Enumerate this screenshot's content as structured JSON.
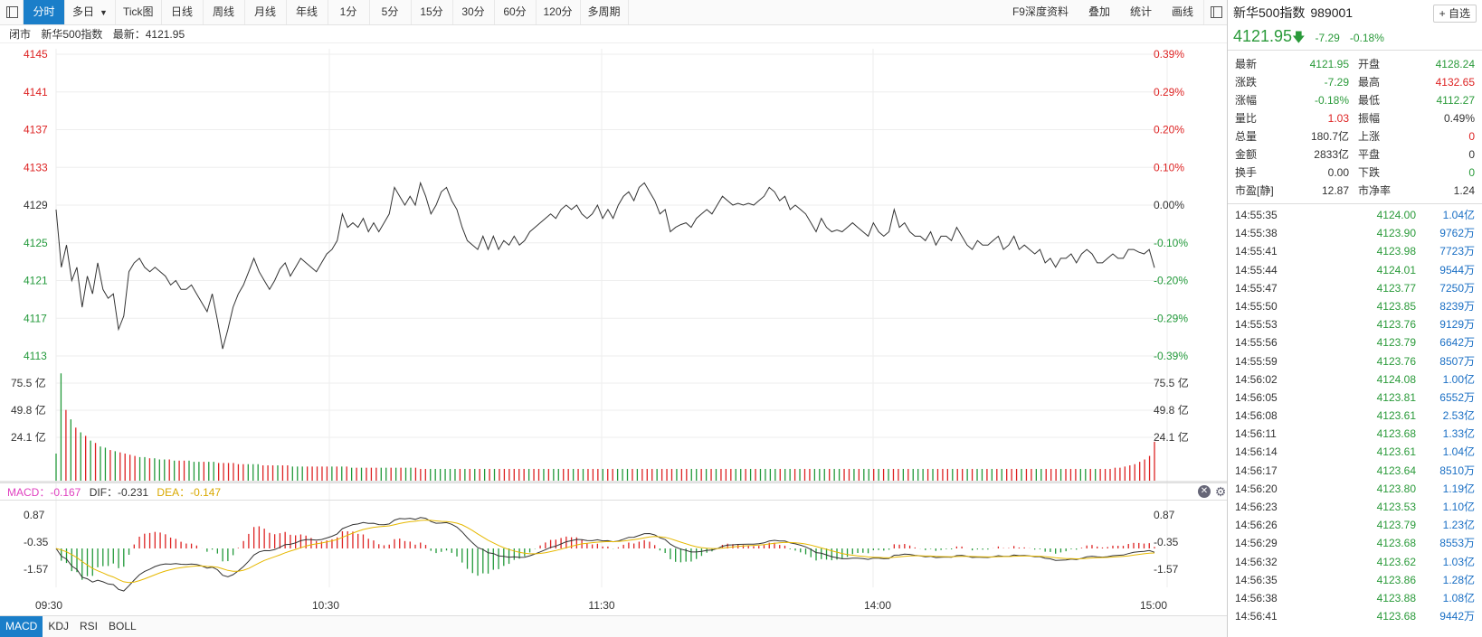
{
  "toolbar": {
    "tabs": [
      "分时",
      "多日",
      "Tick图",
      "日线",
      "周线",
      "月线",
      "年线",
      "1分",
      "5分",
      "15分",
      "30分",
      "60分",
      "120分",
      "多周期"
    ],
    "active": "分时",
    "dropdown_arrow": "▼",
    "right": [
      "F9深度资料",
      "叠加",
      "统计",
      "画线"
    ]
  },
  "info": {
    "status": "闭市",
    "name": "新华500指数",
    "latest": "最新：4121.95"
  },
  "price_axis_left": [
    "4145",
    "4141",
    "4137",
    "4133",
    "4129",
    "4125",
    "4121",
    "4117",
    "4113"
  ],
  "price_axis_right": [
    "0.39%",
    "0.29%",
    "0.20%",
    "0.10%",
    "0.00%",
    "-0.10%",
    "-0.20%",
    "-0.29%",
    "-0.39%"
  ],
  "volume_axis": [
    "75.5 亿",
    "49.8 亿",
    "24.1 亿"
  ],
  "macd_axis": [
    "0.87",
    "-0.35",
    "-1.57"
  ],
  "time_axis": [
    "09:30",
    "10:30",
    "11:30",
    "14:00",
    "15:00"
  ],
  "macd_header": {
    "macd": "MACD：-0.167",
    "dif": "DIF：-0.231",
    "dea": "DEA：-0.147"
  },
  "bottom_tabs": [
    "MACD",
    "KDJ",
    "RSI",
    "BOLL"
  ],
  "colors": {
    "up": "#dd2222",
    "down": "#22993a",
    "accent": "#1a7ec9",
    "line": "#333333",
    "dea": "#e6b800",
    "macd": "#e040c0"
  },
  "panel": {
    "name": "新华500指数",
    "code": "989001",
    "add_label": "+ 自选",
    "price": "4121.95",
    "arrow": "🡇",
    "change": "-7.29",
    "pct": "-0.18%",
    "quotes": [
      {
        "l1": "最新",
        "v1": "4121.95",
        "c1": "green",
        "l2": "开盘",
        "v2": "4128.24",
        "c2": "green"
      },
      {
        "l1": "涨跌",
        "v1": "-7.29",
        "c1": "green",
        "l2": "最高",
        "v2": "4132.65",
        "c2": "red"
      },
      {
        "l1": "涨幅",
        "v1": "-0.18%",
        "c1": "green",
        "l2": "最低",
        "v2": "4112.27",
        "c2": "green"
      },
      {
        "l1": "量比",
        "v1": "1.03",
        "c1": "red",
        "l2": "振幅",
        "v2": "0.49%",
        "c2": "black"
      },
      {
        "l1": "总量",
        "v1": "180.7亿",
        "c1": "black",
        "l2": "上涨",
        "v2": "0",
        "c2": "red"
      },
      {
        "l1": "金额",
        "v1": "2833亿",
        "c1": "black",
        "l2": "平盘",
        "v2": "0",
        "c2": "black"
      },
      {
        "l1": "换手",
        "v1": "0.00",
        "c1": "black",
        "l2": "下跌",
        "v2": "0",
        "c2": "green"
      },
      {
        "l1": "市盈[静]",
        "v1": "12.87",
        "c1": "black",
        "l2": "市净率",
        "v2": "1.24",
        "c2": "black"
      }
    ],
    "ticks": [
      [
        "14:55:35",
        "4124.00",
        "1.04亿"
      ],
      [
        "14:55:38",
        "4123.90",
        "9762万"
      ],
      [
        "14:55:41",
        "4123.98",
        "7723万"
      ],
      [
        "14:55:44",
        "4124.01",
        "9544万"
      ],
      [
        "14:55:47",
        "4123.77",
        "7250万"
      ],
      [
        "14:55:50",
        "4123.85",
        "8239万"
      ],
      [
        "14:55:53",
        "4123.76",
        "9129万"
      ],
      [
        "14:55:56",
        "4123.79",
        "6642万"
      ],
      [
        "14:55:59",
        "4123.76",
        "8507万"
      ],
      [
        "14:56:02",
        "4124.08",
        "1.00亿"
      ],
      [
        "14:56:05",
        "4123.81",
        "6552万"
      ],
      [
        "14:56:08",
        "4123.61",
        "2.53亿"
      ],
      [
        "14:56:11",
        "4123.68",
        "1.33亿"
      ],
      [
        "14:56:14",
        "4123.61",
        "1.04亿"
      ],
      [
        "14:56:17",
        "4123.64",
        "8510万"
      ],
      [
        "14:56:20",
        "4123.80",
        "1.19亿"
      ],
      [
        "14:56:23",
        "4123.53",
        "1.10亿"
      ],
      [
        "14:56:26",
        "4123.79",
        "1.23亿"
      ],
      [
        "14:56:29",
        "4123.68",
        "8553万"
      ],
      [
        "14:56:32",
        "4123.62",
        "1.03亿"
      ],
      [
        "14:56:35",
        "4123.86",
        "1.28亿"
      ],
      [
        "14:56:38",
        "4123.88",
        "1.08亿"
      ],
      [
        "14:56:41",
        "4123.68",
        "9442万"
      ]
    ]
  },
  "chart_data": {
    "type": "line",
    "x_ticks": [
      "09:30",
      "10:30",
      "11:30",
      "14:00",
      "15:00"
    ],
    "prev_close": 4129.24,
    "ylim": [
      4112,
      4146
    ],
    "price": [
      4128.5,
      4122,
      4124.5,
      4120.5,
      4122,
      4117.5,
      4121,
      4119,
      4122.5,
      4119.5,
      4118.5,
      4119,
      4115,
      4116.5,
      4121.5,
      4122.5,
      4123,
      4122,
      4121.5,
      4122,
      4121.5,
      4121,
      4120,
      4120.5,
      4119.5,
      4119.5,
      4120,
      4119,
      4118,
      4117,
      4119,
      4116,
      4112.8,
      4115,
      4117.5,
      4119,
      4120,
      4121.5,
      4123,
      4121.5,
      4120.5,
      4119.5,
      4120.5,
      4121.8,
      4122.5,
      4121,
      4122,
      4123,
      4122.5,
      4122,
      4121.5,
      4122.5,
      4123.5,
      4124,
      4125,
      4128,
      4126.5,
      4127,
      4126.5,
      4127.5,
      4126,
      4127,
      4126,
      4127,
      4128,
      4131,
      4130,
      4129,
      4130,
      4129,
      4131.5,
      4130,
      4128,
      4129,
      4130.5,
      4131,
      4129.5,
      4128.5,
      4126.5,
      4125,
      4124.5,
      4124,
      4125.5,
      4124,
      4125.5,
      4124,
      4125,
      4124.5,
      4125.5,
      4124.5,
      4125,
      4126,
      4126.5,
      4127,
      4127.5,
      4128,
      4127.5,
      4128.5,
      4129,
      4128.5,
      4129,
      4128,
      4127.5,
      4128,
      4129,
      4127.5,
      4128.5,
      4127.5,
      4129,
      4130,
      4130.5,
      4129.5,
      4131,
      4131.5,
      4130.5,
      4129.5,
      4128,
      4128.5,
      4126,
      4126.5,
      4126.8,
      4127,
      4126.5,
      4127.5,
      4128,
      4128.5,
      4128,
      4129,
      4130,
      4129.5,
      4129,
      4129.2,
      4129,
      4129.2,
      4129,
      4129.5,
      4130,
      4131,
      4130.5,
      4129.5,
      4130,
      4128.5,
      4129,
      4128.5,
      4128,
      4127,
      4126,
      4127.5,
      4126.5,
      4126,
      4126.2,
      4126,
      4126.5,
      4127,
      4126.5,
      4126,
      4125.5,
      4127,
      4126,
      4125.5,
      4126,
      4128.5,
      4126.5,
      4127,
      4126,
      4125.5,
      4125.5,
      4125,
      4126,
      4124.5,
      4125.5,
      4125.5,
      4125,
      4126.5,
      4125.5,
      4124.5,
      4124,
      4125,
      4124.5,
      4124.5,
      4125,
      4125.5,
      4124,
      4124.5,
      4125.5,
      4124,
      4124.5,
      4124,
      4123.5,
      4124,
      4122.5,
      4123,
      4122,
      4123,
      4123,
      4123.5,
      4122.5,
      4123.5,
      4124,
      4123.5,
      4122.5,
      4122.5,
      4123,
      4123.5,
      4123,
      4123,
      4124,
      4124,
      4123.7,
      4123.5,
      4124,
      4121.95
    ],
    "volume": [
      23,
      91,
      60,
      52,
      45,
      41,
      38,
      34,
      32,
      29,
      28,
      26,
      25,
      24,
      23,
      22,
      21,
      20,
      20,
      19,
      19,
      18,
      18,
      18,
      17,
      17,
      17,
      17,
      16,
      16,
      16,
      16,
      16,
      15,
      15,
      15,
      15,
      14,
      14,
      14,
      14,
      14,
      13,
      13,
      13,
      13,
      13,
      13,
      12,
      12,
      12,
      12,
      12,
      12,
      12,
      12,
      12,
      12,
      12,
      12,
      11,
      11,
      11,
      11,
      11,
      11,
      11,
      11,
      11,
      11,
      11,
      11,
      11,
      11,
      10,
      10,
      10,
      10,
      10,
      10,
      10,
      10,
      10,
      10,
      10,
      10,
      10,
      10,
      10,
      10,
      10,
      10,
      10,
      10,
      10,
      10,
      10,
      10,
      10,
      10,
      10,
      10,
      10,
      10,
      10,
      10,
      10,
      10,
      10,
      10,
      10,
      10,
      10,
      10,
      10,
      10,
      10,
      10,
      10,
      10,
      10,
      10,
      10,
      10,
      10,
      10,
      10,
      10,
      10,
      10,
      10,
      10,
      10,
      10,
      10,
      10,
      10,
      10,
      10,
      10,
      10,
      10,
      10,
      10,
      10,
      10,
      10,
      10,
      10,
      10,
      10,
      10,
      10,
      10,
      10,
      10,
      10,
      10,
      10,
      10,
      10,
      10,
      10,
      10,
      10,
      10,
      10,
      10,
      10,
      10,
      10,
      10,
      10,
      10,
      10,
      10,
      10,
      10,
      10,
      10,
      10,
      10,
      10,
      10,
      10,
      10,
      10,
      10,
      10,
      10,
      10,
      10,
      10,
      10,
      10,
      10,
      10,
      10,
      10,
      10,
      10,
      10,
      10,
      10,
      10,
      10,
      10,
      10,
      10,
      10,
      10,
      10,
      10,
      10,
      10,
      11,
      11,
      12,
      13,
      14,
      16,
      18,
      21,
      33
    ]
  }
}
